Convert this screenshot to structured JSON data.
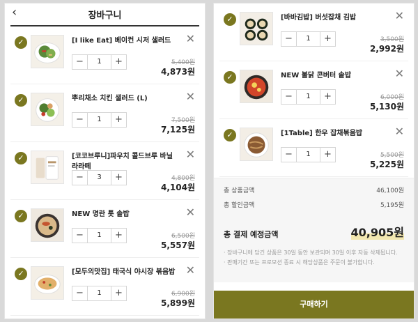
{
  "header": {
    "title": "장바구니",
    "back_icon": "chevron-left-icon"
  },
  "left_items": [
    {
      "name": "[I like Eat] 베이컨 시저 샐러드",
      "qty": "1",
      "original": "5,400원",
      "price": "4,873원"
    },
    {
      "name": "뿌리채소 치킨 샐러드 (L)",
      "qty": "1",
      "original": "7,500원",
      "price": "7,125원"
    },
    {
      "name": "[코코브루니]파우치 콜드브루 바닐라라떼",
      "qty": "3",
      "original": "4,800원",
      "price": "4,104원"
    },
    {
      "name": "NEW 명란 톳 솥밥",
      "qty": "1",
      "original": "6,500원",
      "price": "5,557원"
    },
    {
      "name": "[모두의맛집] 태국식 야시장 볶음밥",
      "qty": "1",
      "original": "6,900원",
      "price": "5,899원"
    }
  ],
  "right_items": [
    {
      "name": "[바바김밥] 버섯잡채 김밥",
      "qty": "1",
      "original": "3,500원",
      "price": "2,992원"
    },
    {
      "name": "NEW 불닭 콘버터 솥밥",
      "qty": "1",
      "original": "6,000원",
      "price": "5,130원"
    },
    {
      "name": "[1Table] 한우 잡채볶음밥",
      "qty": "1",
      "original": "5,500원",
      "price": "5,225원"
    }
  ],
  "summary": {
    "product_total_label": "총 상품금액",
    "product_total": "46,100원",
    "discount_label": "총 할인금액",
    "discount": "5,195원",
    "payment_label": "총 결제 예정금액",
    "payment": "40,905원",
    "note1": "· 장바구니에 담긴 상품은 30일 동안 보관되며 30일 이후 자동 삭제됩니다.",
    "note2": "· 판매기간 또는 프로모션 종료 시 해당상품은 주문이 불가합니다."
  },
  "buy_label": "구매하기",
  "colors": {
    "accent": "#7a7720",
    "highlight": "#f2e7b0"
  }
}
